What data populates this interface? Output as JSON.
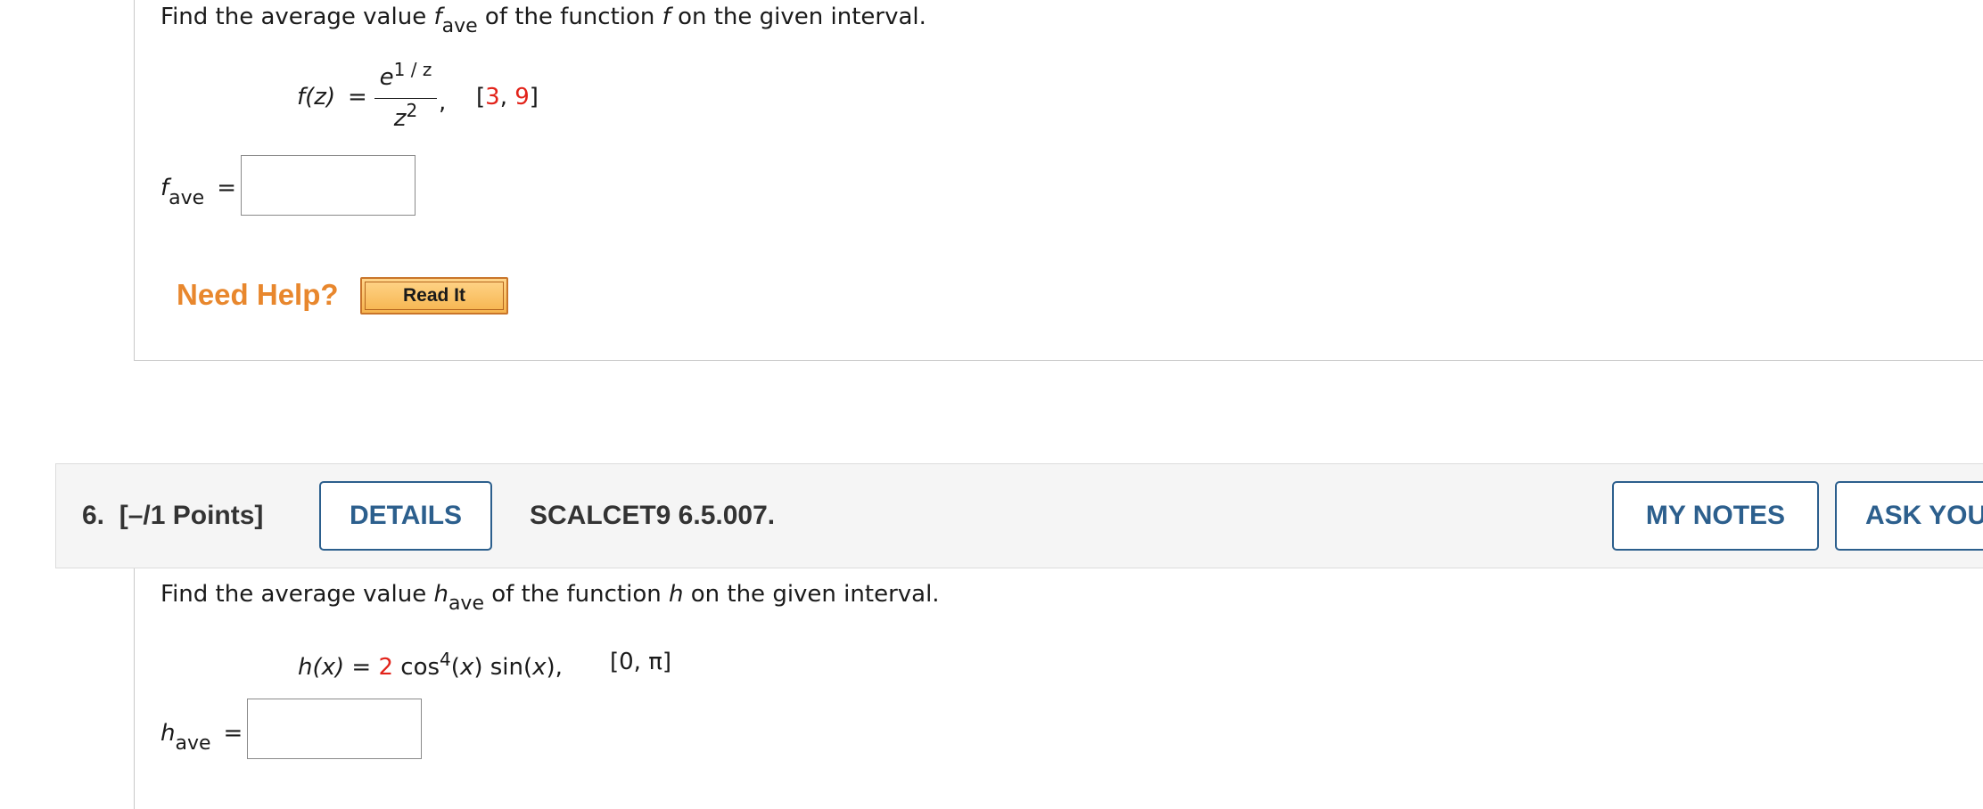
{
  "problem5": {
    "question_prefix": "Find the average value ",
    "question_var": "f",
    "question_sub": "ave",
    "question_mid": " of the function ",
    "question_fn": "f",
    "question_suffix": " on the given interval.",
    "formula_lhs": "f(z)",
    "formula_eq": "=",
    "formula_num_base": "e",
    "formula_num_exp": "1 / z",
    "formula_den_base": "z",
    "formula_den_exp": "2",
    "formula_comma": ",",
    "interval_open": "[",
    "interval_a": "3",
    "interval_sep": ", ",
    "interval_b": "9",
    "interval_close": "]",
    "answer_var": "f",
    "answer_sub": "ave",
    "answer_eq": "=",
    "answer_value": ""
  },
  "help": {
    "need_help": "Need Help?",
    "read_it": "Read It"
  },
  "problem6": {
    "number": "6.",
    "points": "[–/1 Points]",
    "details_button": "DETAILS",
    "source": "SCALCET9 6.5.007.",
    "my_notes_button": "MY NOTES",
    "ask_button": "ASK YOU",
    "question_prefix": "Find the average value ",
    "question_var": "h",
    "question_sub": "ave",
    "question_mid": " of the function ",
    "question_fn": "h",
    "question_suffix": " on the given interval.",
    "formula_lhs": "h(x)",
    "formula_eq": " = ",
    "formula_coef": "2",
    "formula_cos": " cos",
    "formula_cos_exp": "4",
    "formula_arg1_open": "(",
    "formula_arg1_var": "x",
    "formula_arg1_close": ") sin(",
    "formula_arg2_var": "x",
    "formula_end": "),",
    "interval": "[0, π]",
    "answer_var": "h",
    "answer_sub": "ave",
    "answer_eq": "=",
    "answer_value": ""
  },
  "colors": {
    "accent_blue": "#2c5f8d",
    "red_value": "#e2231a",
    "need_help_orange": "#e8872d"
  }
}
